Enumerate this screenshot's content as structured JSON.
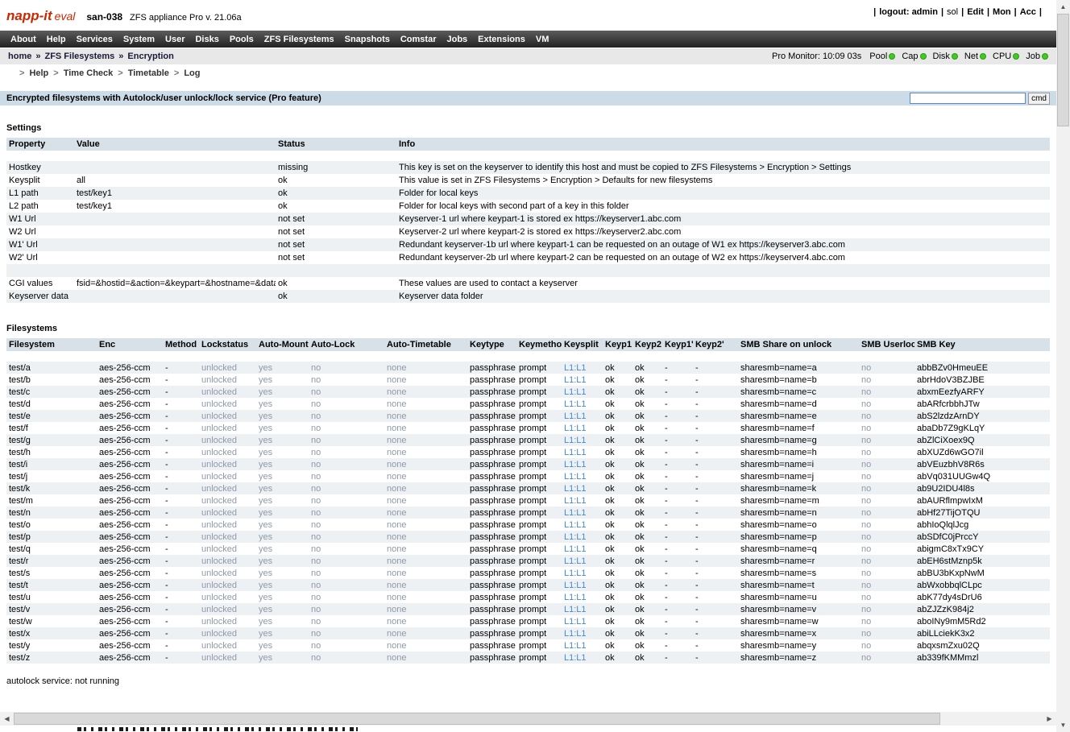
{
  "header": {
    "logo": "napp-it",
    "logo_suffix": "eval",
    "hostname": "san-038",
    "subtitle": "ZFS appliance Pro v. 21.06a",
    "session": {
      "items": [
        {
          "label": "logout: admin",
          "bold": true
        },
        {
          "label": "sol",
          "bold": false
        },
        {
          "label": "Edit",
          "bold": true
        },
        {
          "label": "Mon",
          "bold": true
        },
        {
          "label": "Acc",
          "bold": true
        }
      ]
    }
  },
  "nav": {
    "items": [
      "About",
      "Help",
      "Services",
      "System",
      "User",
      "Disks",
      "Pools",
      "ZFS Filesystems",
      "Snapshots",
      "Comstar",
      "Jobs",
      "Extensions",
      "VM"
    ]
  },
  "breadcrumb": {
    "separator": "»",
    "parts": [
      "home",
      "ZFS Filesystems",
      "Encryption"
    ]
  },
  "monitor": {
    "label": "Pro Monitor: 10:09 03s",
    "status_color": "#3fcc1f",
    "indicators": [
      "Pool",
      "Cap",
      "Disk",
      "Net",
      "CPU",
      "Job"
    ]
  },
  "submenu": {
    "items": [
      "Help",
      "Time Check",
      "Timetable",
      "Log"
    ]
  },
  "titlebar": {
    "title": "Encrypted filesystems with Autolock/user unlock/lock service (Pro feature)",
    "input_value": "",
    "cmd_label": "cmd"
  },
  "settings": {
    "label": "Settings",
    "columns": [
      "Property",
      "Value",
      "Status",
      "Info"
    ],
    "rows": [
      {
        "property": "Hostkey",
        "value": "",
        "status": "missing",
        "info": "This key is set on the keyserver to identify this host and must be copied to ZFS Filesystems > Encryption > Settings"
      },
      {
        "property": "Keysplit",
        "value": "all",
        "status": "ok",
        "info": "This value is set in ZFS Filesystems > Encryption > Defaults for new filesystems"
      },
      {
        "property": "L1 path",
        "value": "test/key1",
        "status": "ok",
        "info": "Folder for local keys"
      },
      {
        "property": "L2 path",
        "value": "test/key1",
        "status": "ok",
        "info": "Folder for local keys with second part of a key in this folder"
      },
      {
        "property": "W1 Url",
        "value": "",
        "status": "not set",
        "info": "Keyserver-1 url where keypart-1 is stored ex https://keyserver1.abc.com"
      },
      {
        "property": "W2 Url",
        "value": "",
        "status": "not set",
        "info": "Keyserver-2 url where keypart-2 is stored ex https://keyserver2.abc.com"
      },
      {
        "property": "W1' Url",
        "value": "",
        "status": "not set",
        "info": "Redundant keyserver-1b url where keypart-1 can be requested on an outage of W1 ex https://keyserver3.abc.com"
      },
      {
        "property": "W2' Url",
        "value": "",
        "status": "not set",
        "info": "Redundant keyserver-2b url where keypart-2 can be requested on an outage of W2 ex https://keyserver4.abc.com"
      },
      {
        "property": "",
        "value": "",
        "status": "",
        "info": ""
      },
      {
        "property": "CGI values",
        "value": "fsid=&hostid=&action=&keypart=&hostname=&data=",
        "status": "ok",
        "info": "These values are used to contact a keyserver"
      },
      {
        "property": "Keyserver data",
        "value": "",
        "status": "ok",
        "info": "Keyserver data folder"
      }
    ]
  },
  "filesystems": {
    "label": "Filesystems",
    "columns": [
      "Filesystem",
      "Enc",
      "Method",
      "Lockstatus",
      "Auto-Mount",
      "Auto-Lock",
      "Auto-Timetable",
      "Keytype",
      "Keymethod",
      "Keysplit",
      "Keyp1",
      "Keyp2",
      "Keyp1'",
      "Keyp2'",
      "SMB Share on unlock",
      "SMB Userlock",
      "SMB Key"
    ],
    "rows": [
      [
        "test/a",
        "aes-256-ccm",
        "-",
        "unlocked",
        "yes",
        "no",
        "none",
        "passphrase",
        "prompt",
        "L1:L1",
        "ok",
        "ok",
        "-",
        "-",
        "sharesmb=name=a",
        "no",
        "abbBZv0HmeuEE"
      ],
      [
        "test/b",
        "aes-256-ccm",
        "-",
        "unlocked",
        "yes",
        "no",
        "none",
        "passphrase",
        "prompt",
        "L1:L1",
        "ok",
        "ok",
        "-",
        "-",
        "sharesmb=name=b",
        "no",
        "abrHdoV3BZJBE"
      ],
      [
        "test/c",
        "aes-256-ccm",
        "-",
        "unlocked",
        "yes",
        "no",
        "none",
        "passphrase",
        "prompt",
        "L1:L1",
        "ok",
        "ok",
        "-",
        "-",
        "sharesmb=name=c",
        "no",
        "abxmEezfyARFY"
      ],
      [
        "test/d",
        "aes-256-ccm",
        "-",
        "unlocked",
        "yes",
        "no",
        "none",
        "passphrase",
        "prompt",
        "L1:L1",
        "ok",
        "ok",
        "-",
        "-",
        "sharesmb=name=d",
        "no",
        "abARfcrbbhJTw"
      ],
      [
        "test/e",
        "aes-256-ccm",
        "-",
        "unlocked",
        "yes",
        "no",
        "none",
        "passphrase",
        "prompt",
        "L1:L1",
        "ok",
        "ok",
        "-",
        "-",
        "sharesmb=name=e",
        "no",
        "abS2lzdzArnDY"
      ],
      [
        "test/f",
        "aes-256-ccm",
        "-",
        "unlocked",
        "yes",
        "no",
        "none",
        "passphrase",
        "prompt",
        "L1:L1",
        "ok",
        "ok",
        "-",
        "-",
        "sharesmb=name=f",
        "no",
        "abaDb7Z9gKLqY"
      ],
      [
        "test/g",
        "aes-256-ccm",
        "-",
        "unlocked",
        "yes",
        "no",
        "none",
        "passphrase",
        "prompt",
        "L1:L1",
        "ok",
        "ok",
        "-",
        "-",
        "sharesmb=name=g",
        "no",
        "abZlCiXoex9Q"
      ],
      [
        "test/h",
        "aes-256-ccm",
        "-",
        "unlocked",
        "yes",
        "no",
        "none",
        "passphrase",
        "prompt",
        "L1:L1",
        "ok",
        "ok",
        "-",
        "-",
        "sharesmb=name=h",
        "no",
        "abXUZd6wGO7il"
      ],
      [
        "test/i",
        "aes-256-ccm",
        "-",
        "unlocked",
        "yes",
        "no",
        "none",
        "passphrase",
        "prompt",
        "L1:L1",
        "ok",
        "ok",
        "-",
        "-",
        "sharesmb=name=i",
        "no",
        "abVEuzbhV8R6s"
      ],
      [
        "test/j",
        "aes-256-ccm",
        "-",
        "unlocked",
        "yes",
        "no",
        "none",
        "passphrase",
        "prompt",
        "L1:L1",
        "ok",
        "ok",
        "-",
        "-",
        "sharesmb=name=j",
        "no",
        "abVq031UUGw4Q"
      ],
      [
        "test/k",
        "aes-256-ccm",
        "-",
        "unlocked",
        "yes",
        "no",
        "none",
        "passphrase",
        "prompt",
        "L1:L1",
        "ok",
        "ok",
        "-",
        "-",
        "sharesmb=name=k",
        "no",
        "ab9U2IDU4l8s"
      ],
      [
        "test/m",
        "aes-256-ccm",
        "-",
        "unlocked",
        "yes",
        "no",
        "none",
        "passphrase",
        "prompt",
        "L1:L1",
        "ok",
        "ok",
        "-",
        "-",
        "sharesmb=name=m",
        "no",
        "abAURflmpwIxM"
      ],
      [
        "test/n",
        "aes-256-ccm",
        "-",
        "unlocked",
        "yes",
        "no",
        "none",
        "passphrase",
        "prompt",
        "L1:L1",
        "ok",
        "ok",
        "-",
        "-",
        "sharesmb=name=n",
        "no",
        "abHf27TijOTQU"
      ],
      [
        "test/o",
        "aes-256-ccm",
        "-",
        "unlocked",
        "yes",
        "no",
        "none",
        "passphrase",
        "prompt",
        "L1:L1",
        "ok",
        "ok",
        "-",
        "-",
        "sharesmb=name=o",
        "no",
        "abhIoQlqlJcg"
      ],
      [
        "test/p",
        "aes-256-ccm",
        "-",
        "unlocked",
        "yes",
        "no",
        "none",
        "passphrase",
        "prompt",
        "L1:L1",
        "ok",
        "ok",
        "-",
        "-",
        "sharesmb=name=p",
        "no",
        "abSDfC0jPrccY"
      ],
      [
        "test/q",
        "aes-256-ccm",
        "-",
        "unlocked",
        "yes",
        "no",
        "none",
        "passphrase",
        "prompt",
        "L1:L1",
        "ok",
        "ok",
        "-",
        "-",
        "sharesmb=name=q",
        "no",
        "abigmC8xTx9CY"
      ],
      [
        "test/r",
        "aes-256-ccm",
        "-",
        "unlocked",
        "yes",
        "no",
        "none",
        "passphrase",
        "prompt",
        "L1:L1",
        "ok",
        "ok",
        "-",
        "-",
        "sharesmb=name=r",
        "no",
        "abEH6stMznp5k"
      ],
      [
        "test/s",
        "aes-256-ccm",
        "-",
        "unlocked",
        "yes",
        "no",
        "none",
        "passphrase",
        "prompt",
        "L1:L1",
        "ok",
        "ok",
        "-",
        "-",
        "sharesmb=name=s",
        "no",
        "abBU3bKxpNwM"
      ],
      [
        "test/t",
        "aes-256-ccm",
        "-",
        "unlocked",
        "yes",
        "no",
        "none",
        "passphrase",
        "prompt",
        "L1:L1",
        "ok",
        "ok",
        "-",
        "-",
        "sharesmb=name=t",
        "no",
        "abWxobbqlCLpc"
      ],
      [
        "test/u",
        "aes-256-ccm",
        "-",
        "unlocked",
        "yes",
        "no",
        "none",
        "passphrase",
        "prompt",
        "L1:L1",
        "ok",
        "ok",
        "-",
        "-",
        "sharesmb=name=u",
        "no",
        "abK77dy4sDrU6"
      ],
      [
        "test/v",
        "aes-256-ccm",
        "-",
        "unlocked",
        "yes",
        "no",
        "none",
        "passphrase",
        "prompt",
        "L1:L1",
        "ok",
        "ok",
        "-",
        "-",
        "sharesmb=name=v",
        "no",
        "abZJZzK984j2"
      ],
      [
        "test/w",
        "aes-256-ccm",
        "-",
        "unlocked",
        "yes",
        "no",
        "none",
        "passphrase",
        "prompt",
        "L1:L1",
        "ok",
        "ok",
        "-",
        "-",
        "sharesmb=name=w",
        "no",
        "aboINy9mM5Rd2"
      ],
      [
        "test/x",
        "aes-256-ccm",
        "-",
        "unlocked",
        "yes",
        "no",
        "none",
        "passphrase",
        "prompt",
        "L1:L1",
        "ok",
        "ok",
        "-",
        "-",
        "sharesmb=name=x",
        "no",
        "abiLLciekK3x2"
      ],
      [
        "test/y",
        "aes-256-ccm",
        "-",
        "unlocked",
        "yes",
        "no",
        "none",
        "passphrase",
        "prompt",
        "L1:L1",
        "ok",
        "ok",
        "-",
        "-",
        "sharesmb=name=y",
        "no",
        "abqxsmZxu02Q"
      ],
      [
        "test/z",
        "aes-256-ccm",
        "-",
        "unlocked",
        "yes",
        "no",
        "none",
        "passphrase",
        "prompt",
        "L1:L1",
        "ok",
        "ok",
        "-",
        "-",
        "sharesmb=name=z",
        "no",
        "ab339fKMMmzl"
      ]
    ]
  },
  "footer": {
    "autolock_status": "autolock service: not running"
  }
}
